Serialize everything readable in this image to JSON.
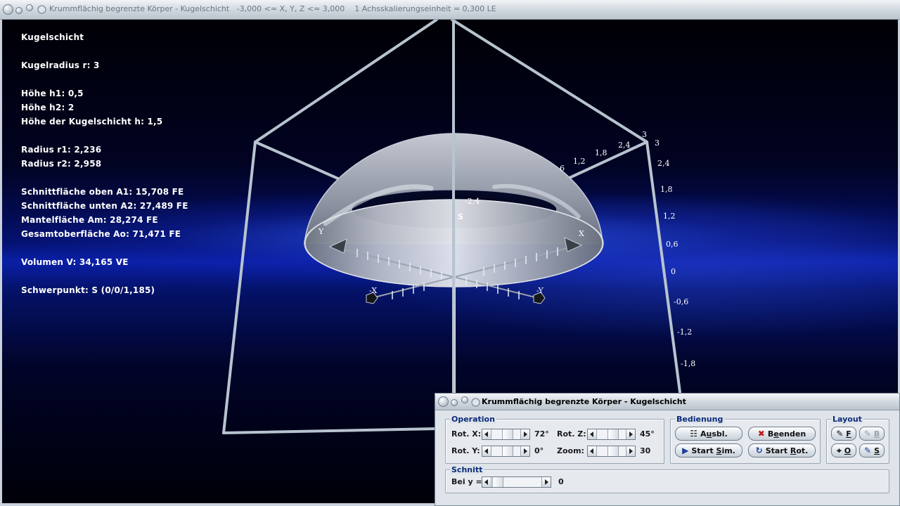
{
  "main_window": {
    "title": "Krummflächig begrenzte Körper - Kugelschicht   -3,000 <= X, Y, Z <= 3,000    1 Achsskalierungseinheit = 0,300 LE"
  },
  "info": {
    "heading": "Kugelschicht",
    "radius": "Kugelradius r: 3",
    "h1": "Höhe h1: 0,5",
    "h2": "Höhe h2: 2",
    "h": "Höhe der Kugelschicht h: 1,5",
    "r1": "Radius r1: 2,236",
    "r2": "Radius r2: 2,958",
    "a1": "Schnittfläche oben A1: 15,708 FE",
    "a2": "Schnittfläche unten A2: 27,489 FE",
    "am": "Mantelfläche Am: 28,274 FE",
    "ao": "Gesamtoberfläche Ao: 71,471 FE",
    "v": "Volumen V: 34,165 VE",
    "s": "Schwerpunkt: S (0/0/1,185)"
  },
  "axes": {
    "x_label": "X",
    "neg_x_label": "-X",
    "y_label": "Y",
    "neg_y_label": "-Y",
    "centroid_label": "S",
    "z_ticks": [
      "3",
      "2,4",
      "1,8",
      "1,2",
      "0,6",
      "0",
      "-0,6",
      "-1,2",
      "-1,8"
    ],
    "top_edge_ticks": [
      "6",
      "1,2",
      "1,8",
      "2,4",
      "3"
    ],
    "inner_tick": "-2,4"
  },
  "control_window": {
    "title": "Krummflächig begrenzte Körper - Kugelschicht",
    "operation": {
      "legend": "Operation",
      "rot_x_label": "Rot. X:",
      "rot_x_value": "72°",
      "rot_y_label": "Rot. Y:",
      "rot_y_value": "0°",
      "rot_z_label": "Rot. Z:",
      "rot_z_value": "45°",
      "zoom_label": "Zoom:",
      "zoom_value": "30"
    },
    "bedienung": {
      "legend": "Bedienung",
      "ausbl_pre": "A",
      "ausbl_u": "u",
      "ausbl_post": "sbl.",
      "beenden_pre": "B",
      "beenden_u": "e",
      "beenden_post": "enden",
      "start_sim_pre": "Start ",
      "start_sim_u": "S",
      "start_sim_post": "im.",
      "start_rot_pre": "Start ",
      "start_rot_u": "R",
      "start_rot_post": "ot."
    },
    "layout": {
      "legend": "Layout",
      "f_label": "F",
      "b_label": "B",
      "o_label": "O",
      "s_label": "S"
    },
    "schnitt": {
      "legend": "Schnitt",
      "bei_label": "Bei y =",
      "bei_value": "0"
    }
  }
}
